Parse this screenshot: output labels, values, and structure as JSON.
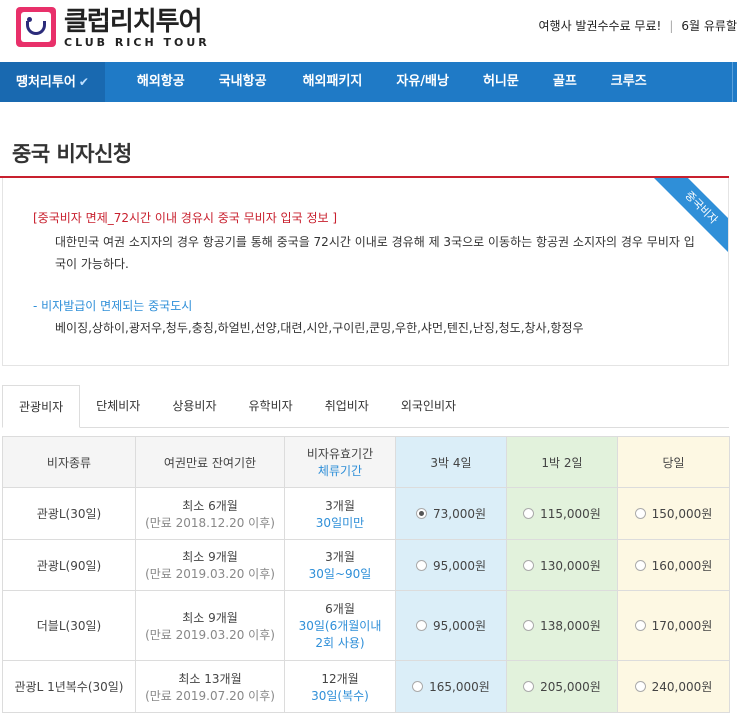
{
  "header": {
    "logo_ko": "클럽리치투어",
    "logo_en": "CLUB RICH TOUR",
    "notice1": "여행사 발권수수료 무료!",
    "notice2": "6월 유류할"
  },
  "nav": {
    "items": [
      {
        "label": "땡처리투어",
        "active": true
      },
      {
        "label": "해외항공"
      },
      {
        "label": "국내항공"
      },
      {
        "label": "해외패키지"
      },
      {
        "label": "자유/배낭"
      },
      {
        "label": "허니문"
      },
      {
        "label": "골프"
      },
      {
        "label": "크루즈"
      }
    ],
    "check": "✔"
  },
  "page": {
    "title": "중국 비자신청",
    "ribbon": "중국비자"
  },
  "info": {
    "heading1": "[중국비자 면제_72시간 이내 경유시 중국 무비자 입국 정보 ]",
    "para1": "대한민국 여권 소지자의 경우 항공기를 통해 중국을 72시간 이내로 경유해 제 3국으로 이동하는 항공권 소지자의 경우 무비자 입국이 가능하다.",
    "heading2": "- 비자발급이 면제되는 중국도시",
    "para2": "베이징,상하이,광저우,청두,충칭,하얼빈,선양,대련,시안,구이린,쿤밍,우한,샤먼,텐진,난징,청도,창사,항정우"
  },
  "tabs": [
    {
      "label": "관광비자",
      "active": true
    },
    {
      "label": "단체비자"
    },
    {
      "label": "상용비자"
    },
    {
      "label": "유학비자"
    },
    {
      "label": "취업비자"
    },
    {
      "label": "외국인비자"
    }
  ],
  "table": {
    "headers": {
      "type": "비자종류",
      "passport": "여권만료 잔여기한",
      "validity": "비자유효기간",
      "validity_sub": "체류기간",
      "p1": "3박 4일",
      "p2": "1박 2일",
      "p3": "당일"
    },
    "rows": [
      {
        "type": "관광L(30일)",
        "passport": "최소 6개월",
        "passport_sub": "(만료 2018.12.20 이후)",
        "validity": "3개월",
        "stay": "30일미만",
        "p1": "73,000원",
        "p2": "115,000원",
        "p3": "150,000원"
      },
      {
        "type": "관광L(90일)",
        "passport": "최소 9개월",
        "passport_sub": "(만료 2019.03.20 이후)",
        "validity": "3개월",
        "stay": "30일~90일",
        "p1": "95,000원",
        "p2": "130,000원",
        "p3": "160,000원"
      },
      {
        "type": "더블L(30일)",
        "passport": "최소 9개월",
        "passport_sub": "(만료 2019.03.20 이후)",
        "validity": "6개월",
        "stay": "30일(6개월이내",
        "stay2": "2회 사용)",
        "p1": "95,000원",
        "p2": "138,000원",
        "p3": "170,000원"
      },
      {
        "type": "관광L 1년복수(30일)",
        "passport": "최소 13개월",
        "passport_sub": "(만료 2019.07.20 이후)",
        "validity": "12개월",
        "stay": "30일(복수)",
        "p1": "165,000원",
        "p2": "205,000원",
        "p3": "240,000원"
      }
    ]
  },
  "colors": {
    "nav_bg": "#1f7ac6",
    "accent_red": "#c8202e",
    "accent_blue": "#2f8fd8",
    "logo_pink": "#e8306a"
  }
}
